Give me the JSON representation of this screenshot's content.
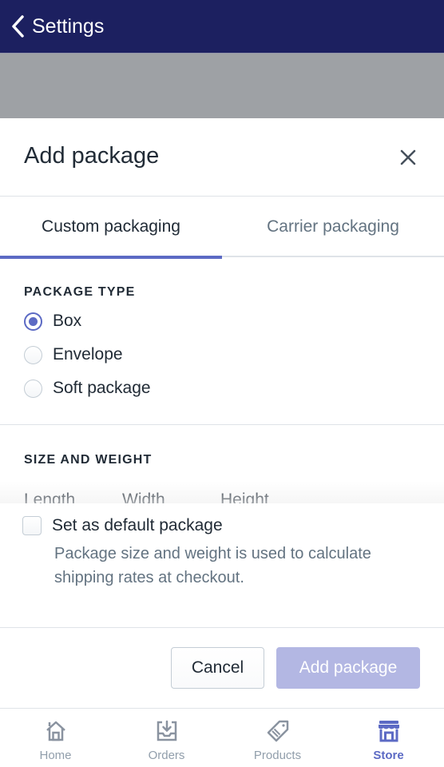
{
  "nav": {
    "back_label": "Settings",
    "back_icon": "chevron-left-icon"
  },
  "sheet": {
    "title": "Add package",
    "close_icon": "close-icon",
    "tabs": [
      {
        "label": "Custom packaging",
        "active": true
      },
      {
        "label": "Carrier packaging",
        "active": false
      }
    ],
    "package_type": {
      "heading": "PACKAGE TYPE",
      "options": [
        {
          "label": "Box",
          "selected": true
        },
        {
          "label": "Envelope",
          "selected": false
        },
        {
          "label": "Soft package",
          "selected": false
        }
      ]
    },
    "size_and_weight": {
      "heading": "SIZE AND WEIGHT",
      "fields": [
        "Length",
        "Width",
        "Height"
      ]
    },
    "default_package": {
      "label": "Set as default package",
      "checked": false,
      "help_text": "Package size and weight is used to calculate shipping rates at checkout."
    },
    "buttons": {
      "cancel": "Cancel",
      "add": "Add package",
      "add_disabled": true
    }
  },
  "tabbar": {
    "items": [
      {
        "label": "Home",
        "icon": "home-icon",
        "active": false
      },
      {
        "label": "Orders",
        "icon": "orders-icon",
        "active": false
      },
      {
        "label": "Products",
        "icon": "tag-icon",
        "active": false
      },
      {
        "label": "Store",
        "icon": "store-icon",
        "active": true
      }
    ]
  },
  "colors": {
    "nav_bg": "#1c2060",
    "accent": "#5c6ac4",
    "disabled_primary": "#b3b7e3",
    "muted_text": "#637381",
    "tabbar_inactive": "#919eab"
  }
}
